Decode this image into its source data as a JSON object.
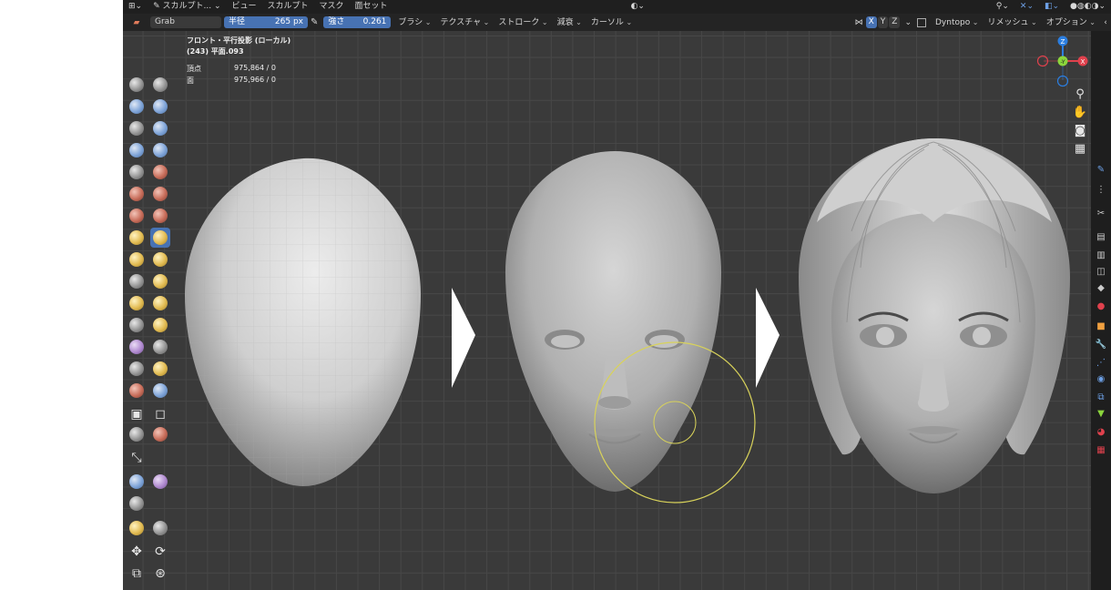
{
  "header": {
    "menu": [
      "スカルプト...",
      "ビュー",
      "スカルプト",
      "マスク",
      "面セット"
    ],
    "brush_name": "Grab",
    "radius_label": "半径",
    "radius_value": "265 px",
    "strength_label": "強さ",
    "strength_value": "0.261",
    "dropdowns": [
      "ブラシ",
      "テクスチャ",
      "ストローク",
      "減衰",
      "カーソル"
    ],
    "axes": [
      "X",
      "Y",
      "Z"
    ],
    "dyntopo": "Dyntopo",
    "remesh": "リメッシュ",
    "options": "オプション"
  },
  "viewport": {
    "view_name": "フロント・平行投影 (ローカル)",
    "object_name": "(243) 平面.093",
    "stats": [
      {
        "label": "頂点",
        "value": "975,864 / 0"
      },
      {
        "label": "面",
        "value": "975,966 / 0"
      }
    ]
  },
  "gizmo": {
    "axis_labels": [
      "Z",
      "-Y",
      "X"
    ],
    "colors": {
      "x": "#e0414d",
      "y": "#8bd63c",
      "z": "#2b7ee0"
    }
  },
  "colors": {
    "accent": "#4772b3",
    "header": "#1f1f1f",
    "viewport_bg": "#3a3a3a",
    "grid": "#474747",
    "brush_circle": "#d8d25a"
  }
}
